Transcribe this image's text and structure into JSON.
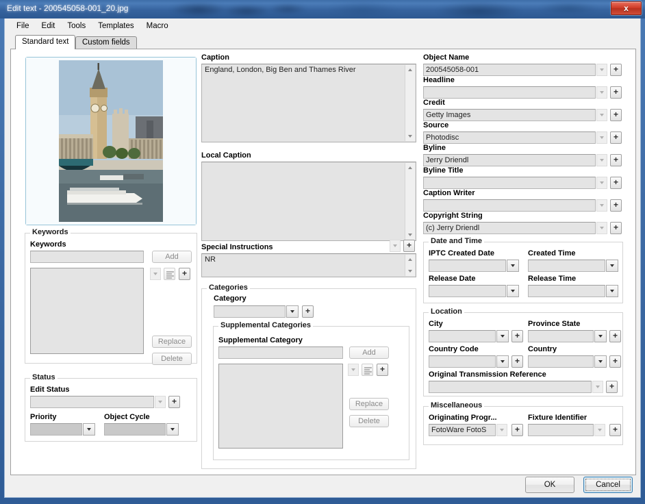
{
  "window": {
    "title": "Edit text - 200545058-001_20.jpg",
    "close_label": "x"
  },
  "menu": {
    "items": [
      {
        "label": "File"
      },
      {
        "label": "Edit"
      },
      {
        "label": "Tools"
      },
      {
        "label": "Templates"
      },
      {
        "label": "Macro"
      }
    ]
  },
  "tabs": [
    {
      "label": "Standard text",
      "active": true
    },
    {
      "label": "Custom fields",
      "active": false
    }
  ],
  "preview": {
    "alt": "England, London, Big Ben and Thames River"
  },
  "keywords": {
    "group_label": "Keywords",
    "field_label": "Keywords",
    "value": "",
    "add_label": "Add",
    "replace_label": "Replace",
    "delete_label": "Delete",
    "list_items": []
  },
  "status": {
    "group_label": "Status",
    "edit_status_label": "Edit Status",
    "edit_status_value": "",
    "priority_label": "Priority",
    "priority_value": "",
    "object_cycle_label": "Object Cycle",
    "object_cycle_value": ""
  },
  "caption": {
    "label": "Caption",
    "value": "England, London, Big Ben and Thames River"
  },
  "local_caption": {
    "label": "Local Caption",
    "value": ""
  },
  "special_instructions": {
    "label": "Special Instructions",
    "value": "NR"
  },
  "categories": {
    "group_label": "Categories",
    "category_label": "Category",
    "category_value": "",
    "supplemental_group_label": "Supplemental Categories",
    "supplemental_label": "Supplemental Category",
    "supplemental_value": "",
    "add_label": "Add",
    "replace_label": "Replace",
    "delete_label": "Delete",
    "list_items": []
  },
  "right_fields": [
    {
      "label": "Object Name",
      "value": "200545058-001"
    },
    {
      "label": "Headline",
      "value": ""
    },
    {
      "label": "Credit",
      "value": "Getty Images"
    },
    {
      "label": "Source",
      "value": "Photodisc"
    },
    {
      "label": "Byline",
      "value": "Jerry Driendl"
    },
    {
      "label": "Byline Title",
      "value": ""
    },
    {
      "label": "Caption Writer",
      "value": ""
    },
    {
      "label": "Copyright String",
      "value": "(c) Jerry Driendl"
    }
  ],
  "date_time": {
    "group_label": "Date and Time",
    "created_date_label": "IPTC Created Date",
    "created_date_value": "",
    "created_time_label": "Created Time",
    "created_time_value": "",
    "release_date_label": "Release Date",
    "release_date_value": "",
    "release_time_label": "Release Time",
    "release_time_value": ""
  },
  "location": {
    "group_label": "Location",
    "city_label": "City",
    "city_value": "",
    "province_label": "Province State",
    "province_value": "",
    "country_code_label": "Country Code",
    "country_code_value": "",
    "country_label": "Country",
    "country_value": "",
    "otr_label": "Original Transmission Reference",
    "otr_value": ""
  },
  "miscellaneous": {
    "group_label": "Miscellaneous",
    "originating_label": "Originating Progr...",
    "originating_value": "FotoWare FotoS",
    "fixture_label": "Fixture Identifier",
    "fixture_value": ""
  },
  "dialog_buttons": {
    "ok_label": "OK",
    "cancel_label": "Cancel"
  },
  "icons": {
    "plus": "+",
    "close": "x"
  },
  "colors": {
    "accent": "#3f6ca6",
    "close_red": "#cf3a26",
    "field_bg": "#e4e4e4",
    "disabled_bg": "#c9c9c9",
    "panel_bg": "#f0f0f0"
  }
}
